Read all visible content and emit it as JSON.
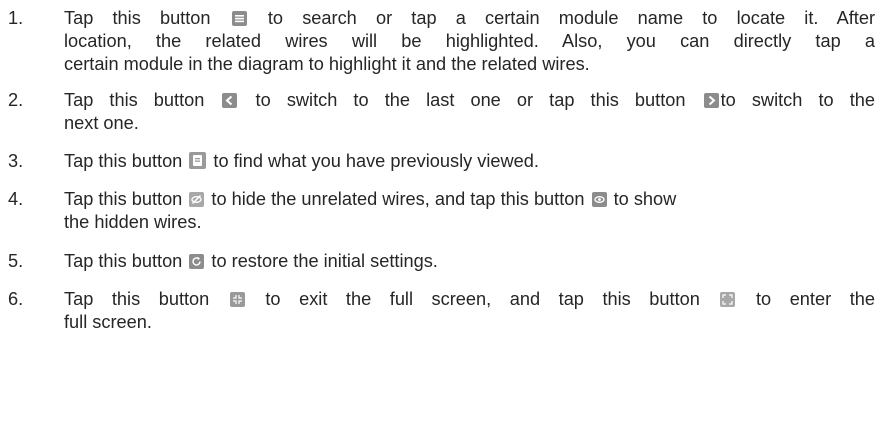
{
  "steps": [
    {
      "number": "1.",
      "lines": [
        [
          "Tap this button ",
          "list-icon",
          " to search or tap a certain module name to locate it. After"
        ],
        [
          "location, the related wires will be highlighted. Also, you can directly tap a"
        ],
        [
          "certain module in the diagram to highlight it and the related wires."
        ]
      ]
    },
    {
      "number": "2.",
      "lines": [
        [
          "Tap this button ",
          "prev-icon",
          " to switch to the last one or tap this button ",
          "next-icon",
          "to switch to the"
        ],
        [
          "next one."
        ]
      ]
    },
    {
      "number": "3.",
      "lines": [
        [
          "Tap this button ",
          "history-icon",
          " to find what you have previously viewed."
        ]
      ]
    },
    {
      "number": "4.",
      "lines": [
        [
          "Tap this button ",
          "hide-icon",
          " to hide the unrelated wires, and tap this button ",
          "show-icon",
          " to show"
        ],
        [
          "the hidden wires."
        ]
      ]
    },
    {
      "number": "5.",
      "lines": [
        [
          "Tap this button ",
          "restore-icon",
          " to restore the initial settings."
        ]
      ]
    },
    {
      "number": "6.",
      "lines": [
        [
          "Tap this button ",
          "exit-fullscreen-icon",
          " to exit the full screen, and tap this button ",
          "enter-fullscreen-icon",
          "  to enter the"
        ],
        [
          "full screen."
        ]
      ]
    }
  ]
}
